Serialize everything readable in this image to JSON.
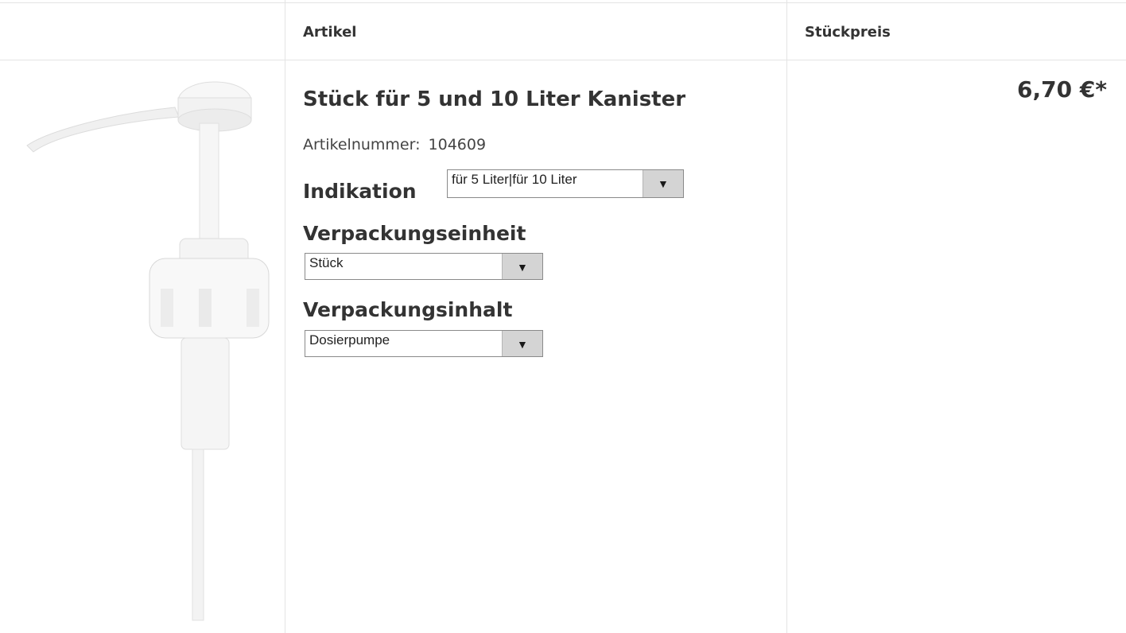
{
  "table": {
    "headers": {
      "artikel": "Artikel",
      "stueckpreis": "Stückpreis"
    }
  },
  "product": {
    "title": "Stück für 5 und 10 Liter Kanister",
    "article_number_label": "Artikelnummer:",
    "article_number": "104609",
    "image_icon": "pump-dispenser-image",
    "options": [
      {
        "label": "Indikation",
        "selected": "für 5 Liter|für 10 Liter"
      },
      {
        "label": "Verpackungseinheit",
        "selected": "Stück"
      },
      {
        "label": "Verpackungsinhalt",
        "selected": "Dosierpumpe"
      }
    ],
    "price": "6,70 €*"
  }
}
